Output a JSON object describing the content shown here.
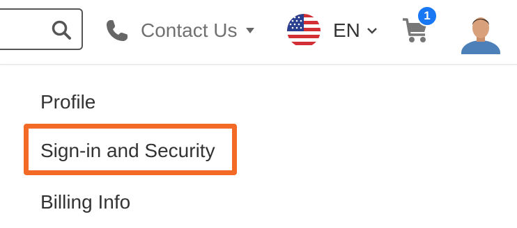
{
  "header": {
    "contact_label": "Contact Us",
    "language_label": "EN",
    "cart_count": "1"
  },
  "icons": {
    "search": "search-icon",
    "phone": "phone-icon",
    "contact_caret": "caret-down-icon",
    "flag": "us-flag-icon",
    "language_chevron": "chevron-down-icon",
    "cart": "cart-icon"
  },
  "menu": {
    "items": [
      {
        "label": "Profile"
      },
      {
        "label": "Sign-in and Security"
      },
      {
        "label": "Billing Info"
      }
    ]
  },
  "colors": {
    "highlight": "#f26a25",
    "badge": "#1877f2",
    "muted_text": "#707070",
    "text": "#333333"
  }
}
